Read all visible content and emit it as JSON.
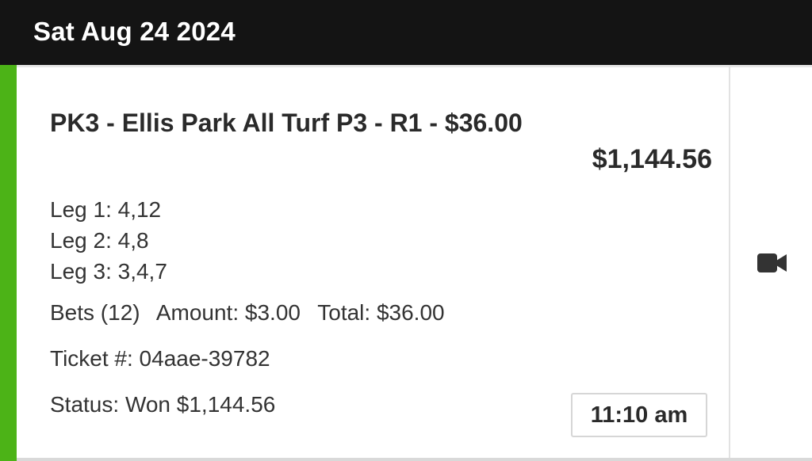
{
  "header": {
    "date": "Sat Aug 24 2024"
  },
  "ticket": {
    "title": "PK3 - Ellis Park All Turf P3 - R1 - $36.00",
    "payout": "$1,144.56",
    "legs": [
      "Leg 1: 4,12",
      "Leg 2: 4,8",
      "Leg 3: 3,4,7"
    ],
    "bets": "Bets (12)",
    "amount": "Amount: $3.00",
    "total": "Total: $36.00",
    "ticket_number": "Ticket #: 04aae-39782",
    "status": "Status: Won $1,144.56",
    "time": "11:10 am",
    "status_color": "#4cb317",
    "video_icon": "video-camera-icon"
  }
}
